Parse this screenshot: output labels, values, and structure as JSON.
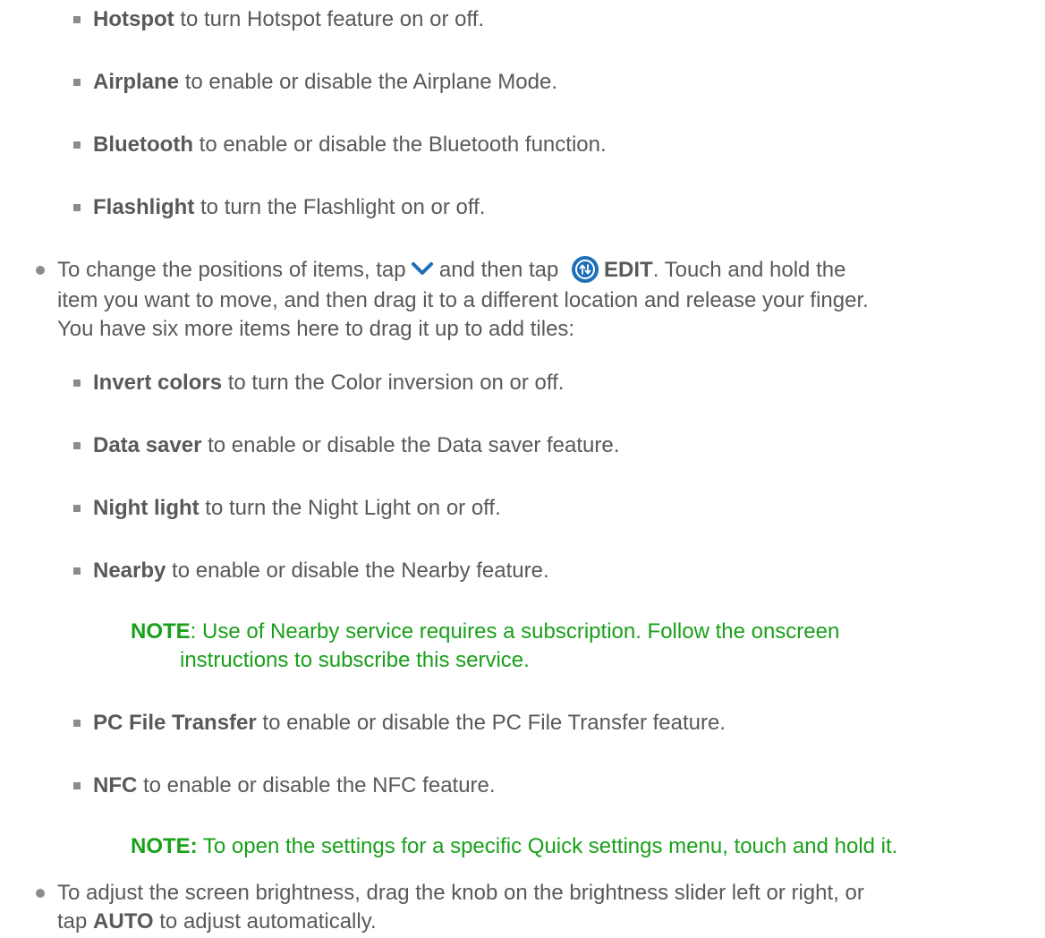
{
  "top_items": [
    {
      "bold": "Hotspot",
      "text": " to turn Hotspot feature on or off."
    },
    {
      "bold": "Airplane",
      "text": " to enable or disable the Airplane Mode."
    },
    {
      "bold": "Bluetooth",
      "text": " to enable or disable the Bluetooth function."
    },
    {
      "bold": "Flashlight",
      "text": " to turn the Flashlight on or off."
    }
  ],
  "positions_bullet": {
    "part1": "To change the positions of items, tap ",
    "part2": " and then tap ",
    "edit_label": "EDIT",
    "part3": ". Touch and hold the",
    "line2": "item you want to move, and then drag it to a different location and release your finger.",
    "line3": "You have six more items here to drag it up to add tiles:"
  },
  "extra_items": [
    {
      "bold": "Invert colors",
      "text": " to turn the Color inversion on or off."
    },
    {
      "bold": "Data saver",
      "text": " to enable or disable the Data saver feature."
    },
    {
      "bold": "Night light",
      "text": " to turn the Night Light on or off."
    },
    {
      "bold": "Nearby",
      "text": " to enable or disable the Nearby feature."
    }
  ],
  "note1": {
    "label": "NOTE",
    "line1": ": Use of Nearby service requires a subscription. Follow the onscreen",
    "line2": "instructions to subscribe this service."
  },
  "more_items": [
    {
      "bold": "PC File Transfer",
      "text": " to enable or disable the PC File Transfer feature."
    },
    {
      "bold": "NFC",
      "text": " to enable or disable the NFC feature."
    }
  ],
  "note2": {
    "label": "NOTE:",
    "text": " To open the settings for a specific Quick settings menu, touch and hold it."
  },
  "brightness_bullet": {
    "line1": "To adjust the screen brightness, drag the knob on the brightness slider left or right, or",
    "line2_prefix": "tap ",
    "auto_label": "AUTO",
    "line2_suffix": " to adjust automatically."
  },
  "icons": {
    "chevron": "chevron-down-icon",
    "edit": "edit-arrows-icon"
  },
  "colors": {
    "body_text": "#595959",
    "note_text": "#19a019",
    "icon_blue": "#1e6fb8",
    "bullet": "#8c8c8c"
  }
}
